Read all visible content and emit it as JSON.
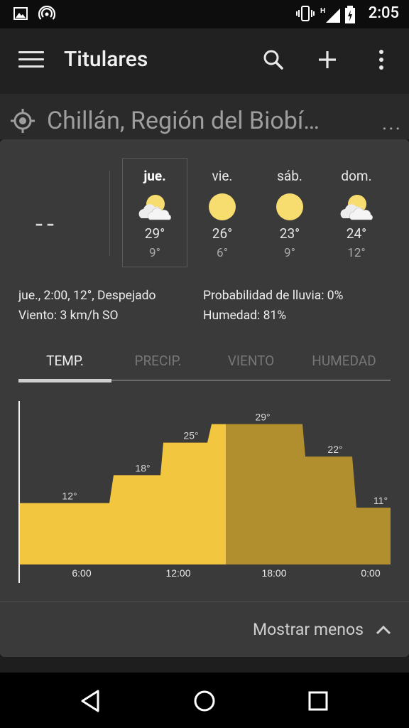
{
  "status": {
    "time": "2:05",
    "network_label": "H"
  },
  "appbar": {
    "title": "Titulares"
  },
  "location": {
    "name": "Chillán, Región del Biobí…",
    "more": "..."
  },
  "current": {
    "temp": "--"
  },
  "forecast": [
    {
      "day": "jue.",
      "high": "29°",
      "low": "9°",
      "icon": "partly-cloudy-icon"
    },
    {
      "day": "vie.",
      "high": "26°",
      "low": "6°",
      "icon": "sun-icon"
    },
    {
      "day": "sáb.",
      "high": "23°",
      "low": "9°",
      "icon": "sun-icon"
    },
    {
      "day": "dom.",
      "high": "24°",
      "low": "12°",
      "icon": "partly-cloudy-icon"
    }
  ],
  "details": {
    "line1": "jue., 2:00, 12°, Despejado",
    "line2": "Viento: 3 km/h SO",
    "rain": "Probabilidad de lluvia: 0%",
    "humidity": "Humedad: 81%"
  },
  "tabs": [
    "TEMP.",
    "PRECIP.",
    "VIENTO",
    "HUMEDAD"
  ],
  "chart_data": {
    "type": "area",
    "x_ticks": [
      "6:00",
      "12:00",
      "18:00",
      "0:00"
    ],
    "steps": [
      {
        "label": "12°",
        "value": 12
      },
      {
        "label": "18°",
        "value": 18
      },
      {
        "label": "25°",
        "value": 25
      },
      {
        "label": "29°",
        "value": 29
      },
      {
        "label": "22°",
        "value": 22
      },
      {
        "label": "11°",
        "value": 11
      }
    ],
    "colors": {
      "past": "#f3c63f",
      "future": "#b18f2e"
    }
  },
  "footer": {
    "show_less": "Mostrar menos"
  }
}
